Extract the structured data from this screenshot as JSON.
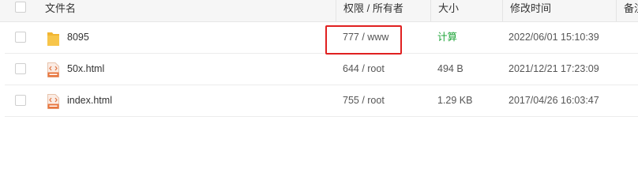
{
  "header": {
    "name": "文件名",
    "permission": "权限 / 所有者",
    "size": "大小",
    "modified": "修改时间",
    "remark": "备注"
  },
  "rows": [
    {
      "name": "8095",
      "type": "folder",
      "permission": "777 / www",
      "size": "计算",
      "modified": "2022/06/01 15:10:39"
    },
    {
      "name": "50x.html",
      "type": "html",
      "permission": "644 / root",
      "size": "494 B",
      "modified": "2021/12/21 17:23:09"
    },
    {
      "name": "index.html",
      "type": "html",
      "permission": "755 / root",
      "size": "1.29 KB",
      "modified": "2017/04/26 16:03:47"
    }
  ],
  "colors": {
    "accent_green": "#20a53a",
    "highlight_red": "#e02020",
    "folder_yellow": "#f7c54a"
  },
  "icons": {
    "folder": "folder-icon",
    "html": "html-file-icon"
  }
}
